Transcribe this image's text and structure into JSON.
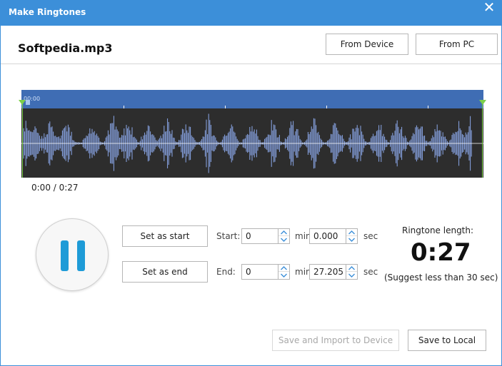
{
  "window": {
    "title": "Make Ringtones",
    "close_glyph": "✕"
  },
  "file": {
    "name": "Softpedia.mp3"
  },
  "source_buttons": {
    "from_device": "From Device",
    "from_pc": "From PC"
  },
  "timeline": {
    "position_label": "00:00",
    "readout": "0:00 / 0:27"
  },
  "controls": {
    "set_start_label": "Set as start",
    "set_end_label": "Set as end",
    "start_label": "Start:",
    "end_label": "End:",
    "start_min": "0",
    "start_sec": "0.000",
    "end_min": "0",
    "end_sec": "27.205",
    "min_unit": "min",
    "sec_unit": "sec"
  },
  "ringtone": {
    "length_label": "Ringtone length:",
    "length_value": "0:27",
    "hint": "(Suggest less than 30 sec)"
  },
  "footer": {
    "save_import_label": "Save and Import to Device",
    "save_local_label": "Save to Local"
  },
  "colors": {
    "titlebar": "#3c8fd9",
    "timeline": "#3f6db4",
    "wave_bg": "#2d2d2d",
    "wave": "#8aa6e8",
    "marker": "#7cd04a",
    "pause": "#1e9bd7"
  },
  "icons": [
    "close-icon",
    "pause-icon",
    "spin-up-icon",
    "spin-down-icon",
    "trim-marker-icon"
  ]
}
